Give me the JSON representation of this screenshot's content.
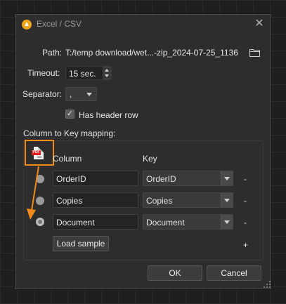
{
  "dialog": {
    "title": "Excel / CSV",
    "close_glyph": "✕",
    "icon": "cloud-upload-icon"
  },
  "path": {
    "label": "Path:",
    "value": "T:/temp download/wet...-zip_2024-07-25_1136",
    "icon": "folder-icon"
  },
  "timeout": {
    "label": "Timeout:",
    "value": "15 sec."
  },
  "separator": {
    "label": "Separator:",
    "value": ","
  },
  "header_row": {
    "label": "Has header row",
    "checked": true,
    "check_glyph": "✓"
  },
  "mapping": {
    "title": "Column to Key mapping:",
    "column_header": "Column",
    "key_header": "Key",
    "file_type_icon": "pdf-icon",
    "file_type_text": "PDF",
    "rows": [
      {
        "column": "OrderID",
        "key": "OrderID",
        "remove": "-"
      },
      {
        "column": "Copies",
        "key": "Copies",
        "remove": "-"
      },
      {
        "column": "Document",
        "key": "Document",
        "remove": "-"
      }
    ],
    "load_sample": "Load sample",
    "add": "+"
  },
  "buttons": {
    "ok": "OK",
    "cancel": "Cancel"
  },
  "colors": {
    "accent_orange": "#f08a1a",
    "dialog_bg": "#2d2d2d",
    "canvas_bg": "#1f1f1f"
  }
}
